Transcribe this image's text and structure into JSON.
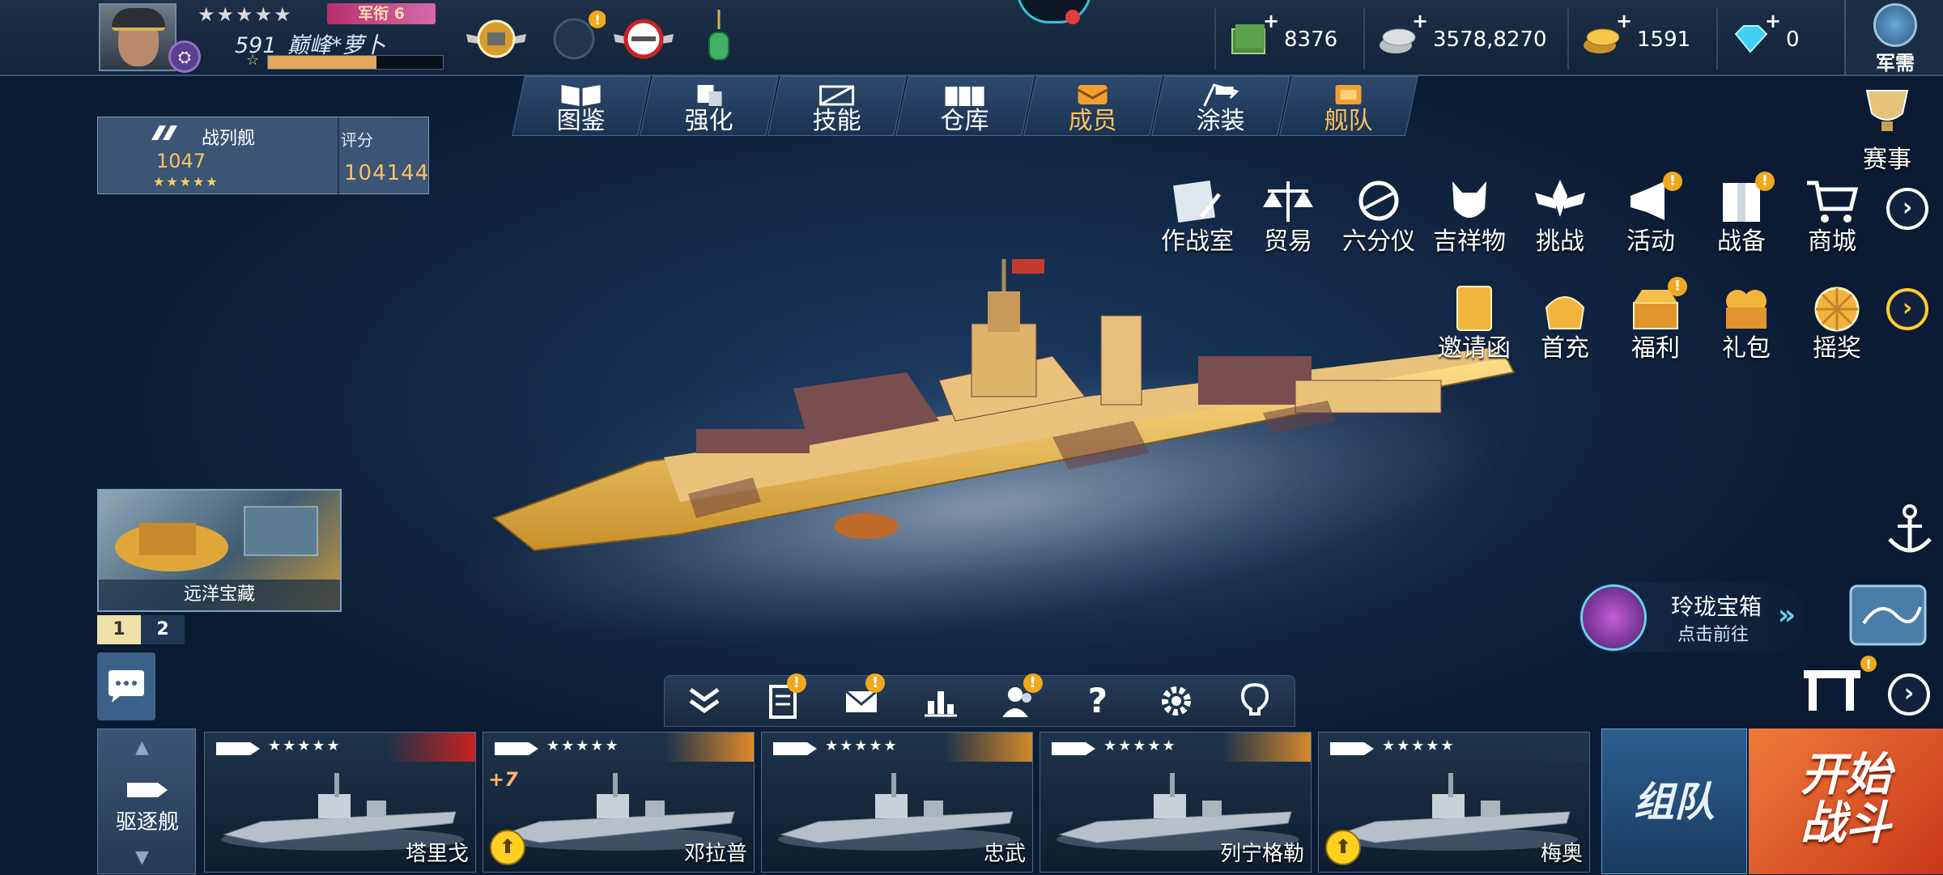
{
  "player": {
    "stars": "★★★★★",
    "rank_tag": "军衔 6",
    "name": "591_巅峰*萝卜",
    "xp_star": "☆",
    "xp_progress": 0.62,
    "avatar": "captain-portrait",
    "rank_icon": "rank-badge-icon"
  },
  "resources": [
    {
      "name": "cash",
      "icon": "cash-icon",
      "value": "8376"
    },
    {
      "name": "silver",
      "icon": "silver-coin-icon",
      "value": "3578,8270"
    },
    {
      "name": "gold",
      "icon": "gold-coin-icon",
      "value": "1591"
    },
    {
      "name": "diamond",
      "icon": "diamond-icon",
      "value": "0"
    }
  ],
  "junxu": {
    "label": "军需",
    "icon": "supply-icon"
  },
  "tabs": [
    {
      "label": "图鉴",
      "icon": "book-icon"
    },
    {
      "label": "强化",
      "icon": "upgrade-icon"
    },
    {
      "label": "技能",
      "icon": "skill-icon"
    },
    {
      "label": "仓库",
      "icon": "warehouse-icon"
    },
    {
      "label": "成员",
      "icon": "crew-icon"
    },
    {
      "label": "涂装",
      "icon": "paint-icon"
    },
    {
      "label": "舰队",
      "icon": "fleet-icon"
    }
  ],
  "ship_info": {
    "class": "战列舰",
    "level": "1047",
    "stars": "★★★★★",
    "score_label": "评分",
    "score": "104144"
  },
  "menu_row1": [
    {
      "label": "作战室",
      "icon": "war-room-icon"
    },
    {
      "label": "贸易",
      "icon": "trade-scale-icon"
    },
    {
      "label": "六分仪",
      "icon": "sextant-icon"
    },
    {
      "label": "吉祥物",
      "icon": "mascot-icon"
    },
    {
      "label": "挑战",
      "icon": "challenge-icon"
    },
    {
      "label": "活动",
      "icon": "activity-icon",
      "badge": "!"
    },
    {
      "label": "战备",
      "icon": "war-prep-icon",
      "badge": "!"
    },
    {
      "label": "商城",
      "icon": "cart-icon"
    }
  ],
  "menu_row2": [
    {
      "label": "邀请函",
      "icon": "invitation-icon"
    },
    {
      "label": "首充",
      "icon": "first-charge-icon"
    },
    {
      "label": "福利",
      "icon": "welfare-chest-icon",
      "badge": "!"
    },
    {
      "label": "礼包",
      "icon": "gift-pack-icon"
    },
    {
      "label": "摇奖",
      "icon": "lottery-icon"
    }
  ],
  "saishi": {
    "label": "赛事",
    "icon": "trophy-icon"
  },
  "treasure": {
    "label": "远洋宝藏",
    "pages": [
      "1",
      "2"
    ]
  },
  "linglong": {
    "title": "玲珑宝箱",
    "subtitle": "点击前往",
    "chevron": "»"
  },
  "toolbar": [
    {
      "icon": "collapse-icon"
    },
    {
      "icon": "task-icon",
      "badge": "!"
    },
    {
      "icon": "mail-icon",
      "badge": "!"
    },
    {
      "icon": "rank-chart-icon"
    },
    {
      "icon": "friends-icon",
      "badge": "!"
    },
    {
      "icon": "help-icon",
      "text": "?"
    },
    {
      "icon": "settings-icon"
    },
    {
      "icon": "hint-icon"
    }
  ],
  "ship_type": {
    "label": "驱逐舰",
    "up": "▲",
    "down": "▼"
  },
  "ships": [
    {
      "name": "塔里戈",
      "stars": "★★★★★",
      "accent": "#c8231e"
    },
    {
      "name": "邓拉普",
      "stars": "★★★★★",
      "accent": "#e08a2a",
      "plus": "+7",
      "upgrade": "⬆"
    },
    {
      "name": "忠武",
      "stars": "★★★★★",
      "accent": "#d4892a"
    },
    {
      "name": "列宁格勒",
      "stars": "★★★★★",
      "accent": "#d4892a"
    },
    {
      "name": "梅奥",
      "stars": "★★★★★",
      "accent": "#1e344c",
      "upgrade": "⬆"
    }
  ],
  "team_button": "组队",
  "start_button": "开始战斗",
  "colors": {
    "gold": "#ffc060",
    "badge": "#f0a91d",
    "start": "#e05a2a",
    "team": "#2d5f8e"
  }
}
